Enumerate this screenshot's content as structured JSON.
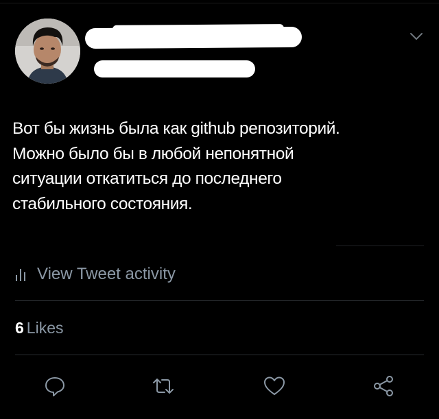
{
  "tweet": {
    "text_lines": [
      "Вот бы жизнь была как github репозиторий.",
      "Можно было бы в любой непонятной",
      "ситуации откатиться до последнего",
      "стабильного состояния."
    ]
  },
  "activity": {
    "label": "View Tweet activity",
    "icon": "bar-chart-icon"
  },
  "likes": {
    "count": "6",
    "label": "Likes"
  },
  "actions": [
    {
      "icon": "reply-icon"
    },
    {
      "icon": "retweet-icon"
    },
    {
      "icon": "like-icon"
    },
    {
      "icon": "share-icon"
    }
  ],
  "colors": {
    "background": "#000000",
    "text": "#ffffff",
    "muted": "#8b98a5",
    "divider": "#2a2d31"
  }
}
